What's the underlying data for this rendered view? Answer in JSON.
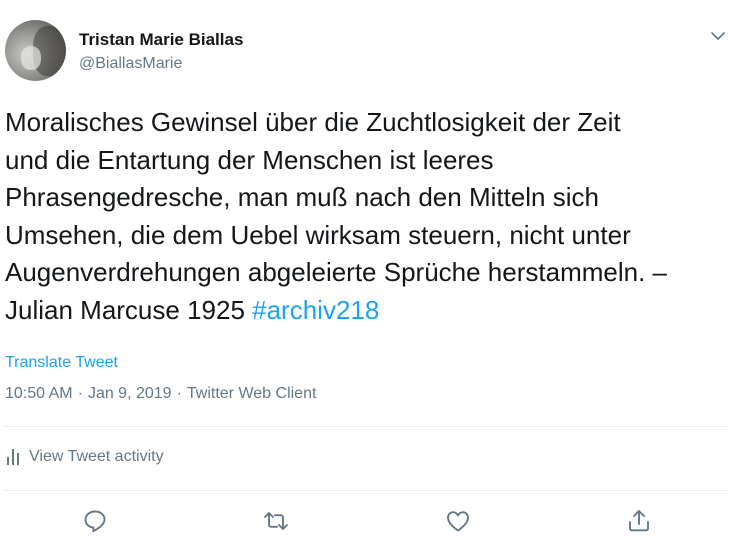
{
  "author": {
    "display_name": "Tristan Marie Biallas",
    "handle": "@BiallasMarie"
  },
  "tweet": {
    "text_before_hashtag": "Moralisches Gewinsel über die Zuchtlosigkeit der Zeit\nund die Entartung der Menschen ist leeres\nPhrasengedresche, man muß nach den Mitteln sich\nUmsehen, die dem Uebel wirksam steuern, nicht unter\nAugenverdrehungen abgeleierte Sprüche herstammeln. –\nJulian Marcuse 1925 ",
    "hashtag": "#archiv218"
  },
  "translate_label": "Translate Tweet",
  "meta": {
    "time": "10:50 AM",
    "separator": "·",
    "date": "Jan 9, 2019",
    "client": "Twitter Web Client"
  },
  "activity_label": "View Tweet activity",
  "icons": {
    "more": "chevron-down-icon",
    "reply": "reply-icon",
    "retweet": "retweet-icon",
    "like": "heart-icon",
    "share": "share-icon",
    "activity": "bar-chart-icon"
  },
  "colors": {
    "accent": "#1da1f2",
    "text": "#14171a",
    "secondary": "#657786",
    "divider": "#e6ecf0"
  }
}
